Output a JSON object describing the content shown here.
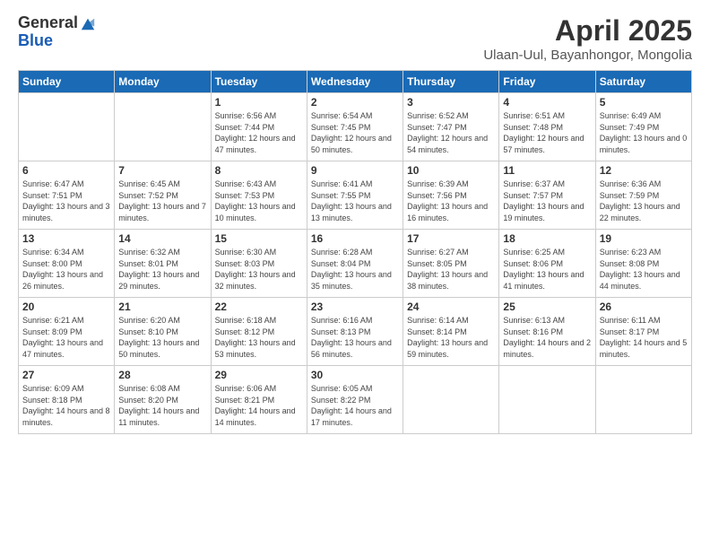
{
  "logo": {
    "general": "General",
    "blue": "Blue"
  },
  "title": "April 2025",
  "subtitle": "Ulaan-Uul, Bayanhongor, Mongolia",
  "days_of_week": [
    "Sunday",
    "Monday",
    "Tuesday",
    "Wednesday",
    "Thursday",
    "Friday",
    "Saturday"
  ],
  "weeks": [
    [
      {
        "day": "",
        "sunrise": "",
        "sunset": "",
        "daylight": ""
      },
      {
        "day": "",
        "sunrise": "",
        "sunset": "",
        "daylight": ""
      },
      {
        "day": "1",
        "sunrise": "Sunrise: 6:56 AM",
        "sunset": "Sunset: 7:44 PM",
        "daylight": "Daylight: 12 hours and 47 minutes."
      },
      {
        "day": "2",
        "sunrise": "Sunrise: 6:54 AM",
        "sunset": "Sunset: 7:45 PM",
        "daylight": "Daylight: 12 hours and 50 minutes."
      },
      {
        "day": "3",
        "sunrise": "Sunrise: 6:52 AM",
        "sunset": "Sunset: 7:47 PM",
        "daylight": "Daylight: 12 hours and 54 minutes."
      },
      {
        "day": "4",
        "sunrise": "Sunrise: 6:51 AM",
        "sunset": "Sunset: 7:48 PM",
        "daylight": "Daylight: 12 hours and 57 minutes."
      },
      {
        "day": "5",
        "sunrise": "Sunrise: 6:49 AM",
        "sunset": "Sunset: 7:49 PM",
        "daylight": "Daylight: 13 hours and 0 minutes."
      }
    ],
    [
      {
        "day": "6",
        "sunrise": "Sunrise: 6:47 AM",
        "sunset": "Sunset: 7:51 PM",
        "daylight": "Daylight: 13 hours and 3 minutes."
      },
      {
        "day": "7",
        "sunrise": "Sunrise: 6:45 AM",
        "sunset": "Sunset: 7:52 PM",
        "daylight": "Daylight: 13 hours and 7 minutes."
      },
      {
        "day": "8",
        "sunrise": "Sunrise: 6:43 AM",
        "sunset": "Sunset: 7:53 PM",
        "daylight": "Daylight: 13 hours and 10 minutes."
      },
      {
        "day": "9",
        "sunrise": "Sunrise: 6:41 AM",
        "sunset": "Sunset: 7:55 PM",
        "daylight": "Daylight: 13 hours and 13 minutes."
      },
      {
        "day": "10",
        "sunrise": "Sunrise: 6:39 AM",
        "sunset": "Sunset: 7:56 PM",
        "daylight": "Daylight: 13 hours and 16 minutes."
      },
      {
        "day": "11",
        "sunrise": "Sunrise: 6:37 AM",
        "sunset": "Sunset: 7:57 PM",
        "daylight": "Daylight: 13 hours and 19 minutes."
      },
      {
        "day": "12",
        "sunrise": "Sunrise: 6:36 AM",
        "sunset": "Sunset: 7:59 PM",
        "daylight": "Daylight: 13 hours and 22 minutes."
      }
    ],
    [
      {
        "day": "13",
        "sunrise": "Sunrise: 6:34 AM",
        "sunset": "Sunset: 8:00 PM",
        "daylight": "Daylight: 13 hours and 26 minutes."
      },
      {
        "day": "14",
        "sunrise": "Sunrise: 6:32 AM",
        "sunset": "Sunset: 8:01 PM",
        "daylight": "Daylight: 13 hours and 29 minutes."
      },
      {
        "day": "15",
        "sunrise": "Sunrise: 6:30 AM",
        "sunset": "Sunset: 8:03 PM",
        "daylight": "Daylight: 13 hours and 32 minutes."
      },
      {
        "day": "16",
        "sunrise": "Sunrise: 6:28 AM",
        "sunset": "Sunset: 8:04 PM",
        "daylight": "Daylight: 13 hours and 35 minutes."
      },
      {
        "day": "17",
        "sunrise": "Sunrise: 6:27 AM",
        "sunset": "Sunset: 8:05 PM",
        "daylight": "Daylight: 13 hours and 38 minutes."
      },
      {
        "day": "18",
        "sunrise": "Sunrise: 6:25 AM",
        "sunset": "Sunset: 8:06 PM",
        "daylight": "Daylight: 13 hours and 41 minutes."
      },
      {
        "day": "19",
        "sunrise": "Sunrise: 6:23 AM",
        "sunset": "Sunset: 8:08 PM",
        "daylight": "Daylight: 13 hours and 44 minutes."
      }
    ],
    [
      {
        "day": "20",
        "sunrise": "Sunrise: 6:21 AM",
        "sunset": "Sunset: 8:09 PM",
        "daylight": "Daylight: 13 hours and 47 minutes."
      },
      {
        "day": "21",
        "sunrise": "Sunrise: 6:20 AM",
        "sunset": "Sunset: 8:10 PM",
        "daylight": "Daylight: 13 hours and 50 minutes."
      },
      {
        "day": "22",
        "sunrise": "Sunrise: 6:18 AM",
        "sunset": "Sunset: 8:12 PM",
        "daylight": "Daylight: 13 hours and 53 minutes."
      },
      {
        "day": "23",
        "sunrise": "Sunrise: 6:16 AM",
        "sunset": "Sunset: 8:13 PM",
        "daylight": "Daylight: 13 hours and 56 minutes."
      },
      {
        "day": "24",
        "sunrise": "Sunrise: 6:14 AM",
        "sunset": "Sunset: 8:14 PM",
        "daylight": "Daylight: 13 hours and 59 minutes."
      },
      {
        "day": "25",
        "sunrise": "Sunrise: 6:13 AM",
        "sunset": "Sunset: 8:16 PM",
        "daylight": "Daylight: 14 hours and 2 minutes."
      },
      {
        "day": "26",
        "sunrise": "Sunrise: 6:11 AM",
        "sunset": "Sunset: 8:17 PM",
        "daylight": "Daylight: 14 hours and 5 minutes."
      }
    ],
    [
      {
        "day": "27",
        "sunrise": "Sunrise: 6:09 AM",
        "sunset": "Sunset: 8:18 PM",
        "daylight": "Daylight: 14 hours and 8 minutes."
      },
      {
        "day": "28",
        "sunrise": "Sunrise: 6:08 AM",
        "sunset": "Sunset: 8:20 PM",
        "daylight": "Daylight: 14 hours and 11 minutes."
      },
      {
        "day": "29",
        "sunrise": "Sunrise: 6:06 AM",
        "sunset": "Sunset: 8:21 PM",
        "daylight": "Daylight: 14 hours and 14 minutes."
      },
      {
        "day": "30",
        "sunrise": "Sunrise: 6:05 AM",
        "sunset": "Sunset: 8:22 PM",
        "daylight": "Daylight: 14 hours and 17 minutes."
      },
      {
        "day": "",
        "sunrise": "",
        "sunset": "",
        "daylight": ""
      },
      {
        "day": "",
        "sunrise": "",
        "sunset": "",
        "daylight": ""
      },
      {
        "day": "",
        "sunrise": "",
        "sunset": "",
        "daylight": ""
      }
    ]
  ]
}
